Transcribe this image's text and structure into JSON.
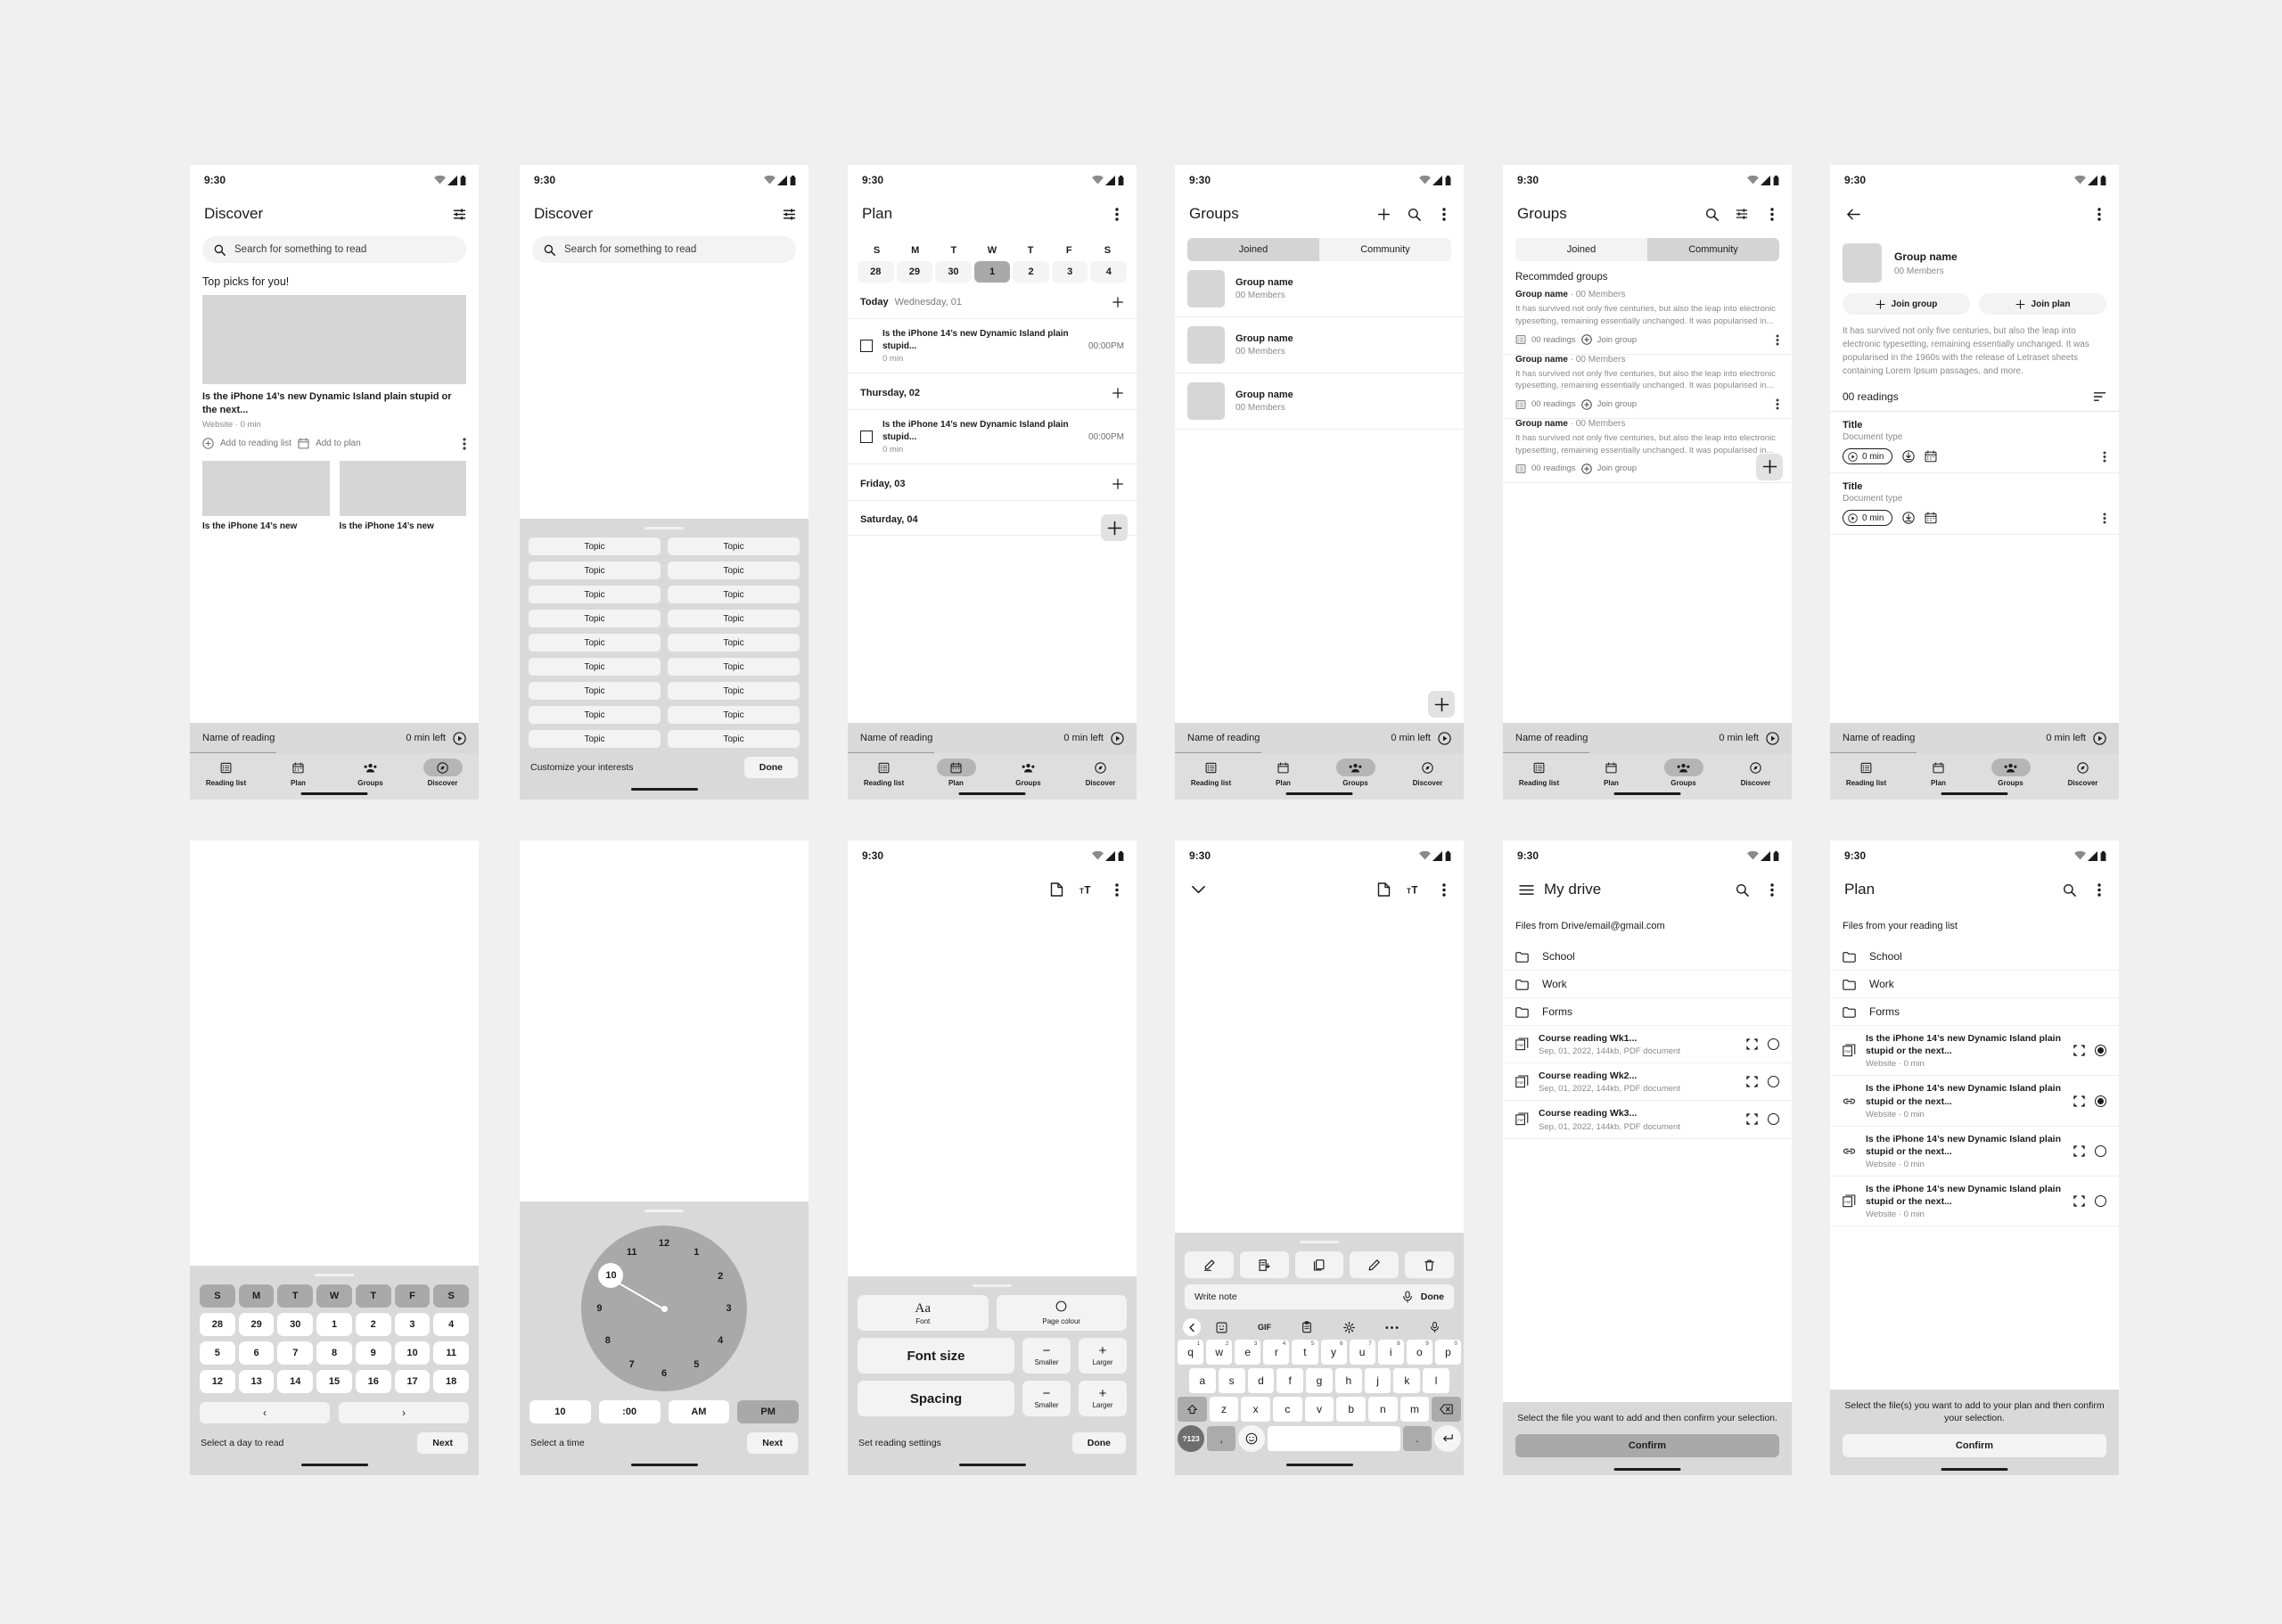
{
  "status": {
    "time": "9:30"
  },
  "common": {
    "player": {
      "name": "Name of reading",
      "time": "0 min left"
    },
    "nav": [
      {
        "label": "Reading list",
        "icon": "list-icon"
      },
      {
        "label": "Plan",
        "icon": "calendar-icon"
      },
      {
        "label": "Groups",
        "icon": "groups-icon"
      },
      {
        "label": "Discover",
        "icon": "compass-icon"
      }
    ]
  },
  "screen1": {
    "title": "Discover",
    "search_placeholder": "Search for something to read",
    "section": "Top picks for you!",
    "hero": {
      "title": "Is the iPhone 14’s new Dynamic Island plain stupid or the next...",
      "meta": "Website · 0 min",
      "action1": "Add to reading list",
      "action2": "Add to plan"
    },
    "tiles": [
      {
        "title": "Is the iPhone 14’s new"
      },
      {
        "title": "Is the iPhone 14’s new"
      }
    ],
    "active_nav": "Discover"
  },
  "screen2": {
    "title": "Discover",
    "search_placeholder": "Search for something to read",
    "topics": [
      "Topic",
      "Topic",
      "Topic",
      "Topic",
      "Topic",
      "Topic",
      "Topic",
      "Topic",
      "Topic",
      "Topic",
      "Topic",
      "Topic",
      "Topic",
      "Topic",
      "Topic",
      "Topic",
      "Topic",
      "Topic"
    ],
    "footer_label": "Customize your interests",
    "done_label": "Done"
  },
  "screen3": {
    "title": "Plan",
    "dow": [
      "S",
      "M",
      "T",
      "W",
      "T",
      "F",
      "S"
    ],
    "dates": [
      "28",
      "29",
      "30",
      "1",
      "2",
      "3",
      "4"
    ],
    "selected_date": "1",
    "day_sections": [
      {
        "label": "Today",
        "sub": "Wednesday, 01",
        "items": [
          {
            "title": "Is the iPhone 14’s new Dynamic Island plain stupid...",
            "minutes": "0 min",
            "time": "00:00PM"
          }
        ]
      },
      {
        "label": "Thursday, 02",
        "sub": "",
        "items": [
          {
            "title": "Is the iPhone 14’s new Dynamic Island plain stupid...",
            "minutes": "0 min",
            "time": "00:00PM"
          }
        ]
      },
      {
        "label": "Friday, 03",
        "sub": "",
        "items": []
      },
      {
        "label": "Saturday, 04",
        "sub": "",
        "items": []
      }
    ],
    "active_nav": "Plan"
  },
  "screen4": {
    "title": "Groups",
    "tabs": [
      {
        "label": "Joined",
        "active": true
      },
      {
        "label": "Community",
        "active": false
      }
    ],
    "groups": [
      {
        "name": "Group name",
        "members": "00 Members"
      },
      {
        "name": "Group name",
        "members": "00 Members"
      },
      {
        "name": "Group name",
        "members": "00 Members"
      }
    ],
    "active_nav": "Groups"
  },
  "screen5": {
    "title": "Groups",
    "tabs": [
      {
        "label": "Joined",
        "active": false
      },
      {
        "label": "Community",
        "active": true
      }
    ],
    "section": "Recommded groups",
    "cards": [
      {
        "name": "Group name",
        "members": "· 00 Members",
        "body": "It has survived not only five centuries, but also the leap into electronic typesetting, remaining essentially unchanged. It was popularised in...",
        "readings": "00 readings",
        "join": "Join group"
      },
      {
        "name": "Group name",
        "members": "· 00 Members",
        "body": "It has survived not only five centuries, but also the leap into electronic typesetting, remaining essentially unchanged. It was popularised in...",
        "readings": "00 readings",
        "join": "Join group"
      },
      {
        "name": "Group name",
        "members": "· 00 Members",
        "body": "It has survived not only five centuries, but also the leap into electronic typesetting, remaining essentially unchanged. It was popularised in...",
        "readings": "00 readings",
        "join": "Join group"
      }
    ],
    "active_nav": "Groups"
  },
  "screen6": {
    "group": {
      "name": "Group name",
      "members": "00 Members"
    },
    "join_group": "Join group",
    "join_plan": "Join plan",
    "description": "It has survived not only five centuries, but also the leap into electronic typesetting, remaining essentially unchanged. It was popularised in the 1960s with the release of Letraset sheets containing Lorem Ipsum passages, and more.",
    "readings_count": "00 readings",
    "readings": [
      {
        "title": "Title",
        "subtitle": "Document type",
        "duration": "0 min"
      },
      {
        "title": "Title",
        "subtitle": "Document type",
        "duration": "0 min"
      }
    ],
    "active_nav": "Groups"
  },
  "screen7": {
    "dow": [
      "S",
      "M",
      "T",
      "W",
      "T",
      "F",
      "S"
    ],
    "weeks": [
      [
        "28",
        "29",
        "30",
        "1",
        "2",
        "3",
        "4"
      ],
      [
        "5",
        "6",
        "7",
        "8",
        "9",
        "10",
        "11"
      ],
      [
        "12",
        "13",
        "14",
        "15",
        "16",
        "17",
        "18"
      ]
    ],
    "prev": "‹",
    "next_arrow": "›",
    "footer_label": "Select a day to read",
    "next_label": "Next"
  },
  "screen8": {
    "clock_numbers": [
      "12",
      "1",
      "2",
      "3",
      "4",
      "5",
      "6",
      "7",
      "8",
      "9",
      "10",
      "11"
    ],
    "selected_hour": "10",
    "hour_field": "10",
    "minute_field": ":00",
    "am_label": "AM",
    "pm_label": "PM",
    "meridiem_selected": "PM",
    "footer_label": "Select a time",
    "next_label": "Next"
  },
  "screen9": {
    "font_glyph": "Aa",
    "font_label": "Font",
    "page_colour_label": "Page colour",
    "font_size_label": "Font size",
    "spacing_label": "Spacing",
    "smaller_label": "Smaller",
    "larger_label": "Larger",
    "minus": "−",
    "plus": "+",
    "footer_label": "Set reading settings",
    "done_label": "Done"
  },
  "screen10": {
    "note_placeholder": "Write note",
    "done_label": "Done",
    "toolbar_icons": [
      "edit-note-icon",
      "note-add-icon",
      "copy-icon",
      "pencil-icon",
      "trash-icon"
    ],
    "kb_topbar": [
      "sticker-icon",
      "GIF",
      "clipboard-icon",
      "gear-icon",
      "more-icon",
      "mic-icon"
    ],
    "row1": [
      "q",
      "w",
      "e",
      "r",
      "t",
      "y",
      "u",
      "i",
      "o",
      "p"
    ],
    "row1_nums": [
      "1",
      "2",
      "3",
      "4",
      "5",
      "6",
      "7",
      "8",
      "9",
      "0"
    ],
    "row2": [
      "a",
      "s",
      "d",
      "f",
      "g",
      "h",
      "j",
      "k",
      "l"
    ],
    "row3": [
      "z",
      "x",
      "c",
      "v",
      "b",
      "n",
      "m"
    ],
    "shift_key": "⇧",
    "backspace_key": "⌫",
    "sym_key": "?123",
    "comma_key": ",",
    "emoji_key": "☺",
    "period_key": ".",
    "enter_key": "↵"
  },
  "screen11": {
    "title": "My drive",
    "hint": "Files from Drive/email@gmail.com",
    "folders": [
      "School",
      "Work",
      "Forms"
    ],
    "files": [
      {
        "name": "Course reading Wk1...",
        "meta": "Sep, 01, 2022, 144kb, PDF document",
        "selected": false,
        "icon": "pdf-icon"
      },
      {
        "name": "Course reading Wk2...",
        "meta": "Sep, 01, 2022, 144kb, PDF document",
        "selected": false,
        "icon": "pdf-icon"
      },
      {
        "name": "Course reading Wk3...",
        "meta": "Sep, 01, 2022, 144kb, PDF document",
        "selected": false,
        "icon": "pdf-icon"
      }
    ],
    "confirm_msg": "Select the file you want to add and then confirm your selection.",
    "confirm_label": "Confirm"
  },
  "screen12": {
    "title": "Plan",
    "hint": "Files from your reading list",
    "folders": [
      "School",
      "Work",
      "Forms"
    ],
    "files": [
      {
        "name": "Is the iPhone 14’s new Dynamic Island plain stupid or the next...",
        "meta": "Website · 0 min",
        "selected": true,
        "icon": "pdf-icon"
      },
      {
        "name": "Is the iPhone 14’s new Dynamic Island plain stupid or the next...",
        "meta": "Website · 0 min",
        "selected": true,
        "icon": "link-icon"
      },
      {
        "name": "Is the iPhone 14’s new Dynamic Island plain stupid or the next...",
        "meta": "Website · 0 min",
        "selected": false,
        "icon": "link-icon"
      },
      {
        "name": "Is the iPhone 14’s new Dynamic Island plain stupid or the next...",
        "meta": "Website · 0 min",
        "selected": false,
        "icon": "pdf-icon"
      }
    ],
    "confirm_msg": "Select the file(s) you want to add to your plan and then confirm your selection.",
    "confirm_label": "Confirm"
  },
  "colors": {
    "bg": "#f0f0f0",
    "surface": "#ffffff",
    "chrome": "#d9d9d9",
    "accent": "#a9a9a9",
    "muted": "#8a8a8a"
  }
}
